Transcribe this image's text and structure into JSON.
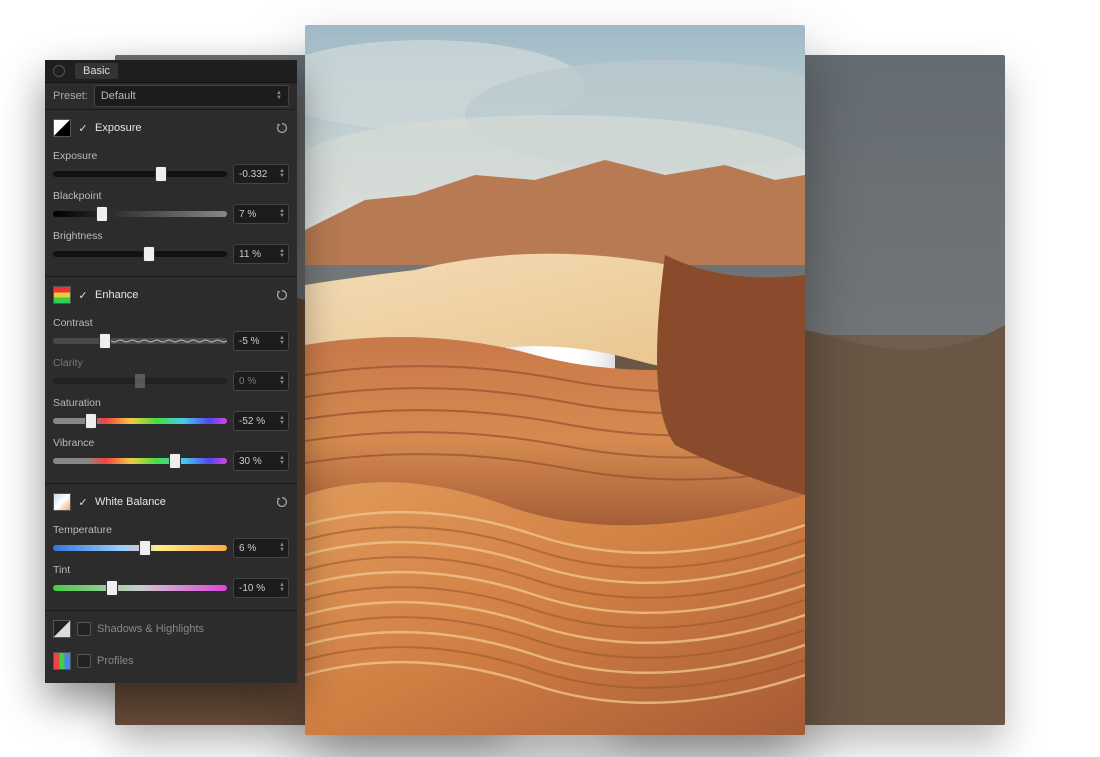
{
  "panel": {
    "tab": "Basic",
    "preset_label": "Preset:",
    "preset_value": "Default"
  },
  "sections": {
    "exposure": {
      "title": "Exposure",
      "sliders": {
        "exposure": {
          "label": "Exposure",
          "value": "-0.332",
          "pos": 62
        },
        "blackpoint": {
          "label": "Blackpoint",
          "value": "7 %",
          "pos": 28
        },
        "brightness": {
          "label": "Brightness",
          "value": "11 %",
          "pos": 55
        }
      }
    },
    "enhance": {
      "title": "Enhance",
      "sliders": {
        "contrast": {
          "label": "Contrast",
          "value": "-5 %",
          "pos": 30
        },
        "clarity": {
          "label": "Clarity",
          "value": "0 %",
          "pos": 50
        },
        "saturation": {
          "label": "Saturation",
          "value": "-52 %",
          "pos": 22
        },
        "vibrance": {
          "label": "Vibrance",
          "value": "30 %",
          "pos": 70
        }
      }
    },
    "white_balance": {
      "title": "White Balance",
      "sliders": {
        "temperature": {
          "label": "Temperature",
          "value": "6 %",
          "pos": 53
        },
        "tint": {
          "label": "Tint",
          "value": "-10 %",
          "pos": 34
        }
      }
    },
    "shadows_highlights": {
      "title": "Shadows & Highlights"
    },
    "profiles": {
      "title": "Profiles"
    }
  }
}
